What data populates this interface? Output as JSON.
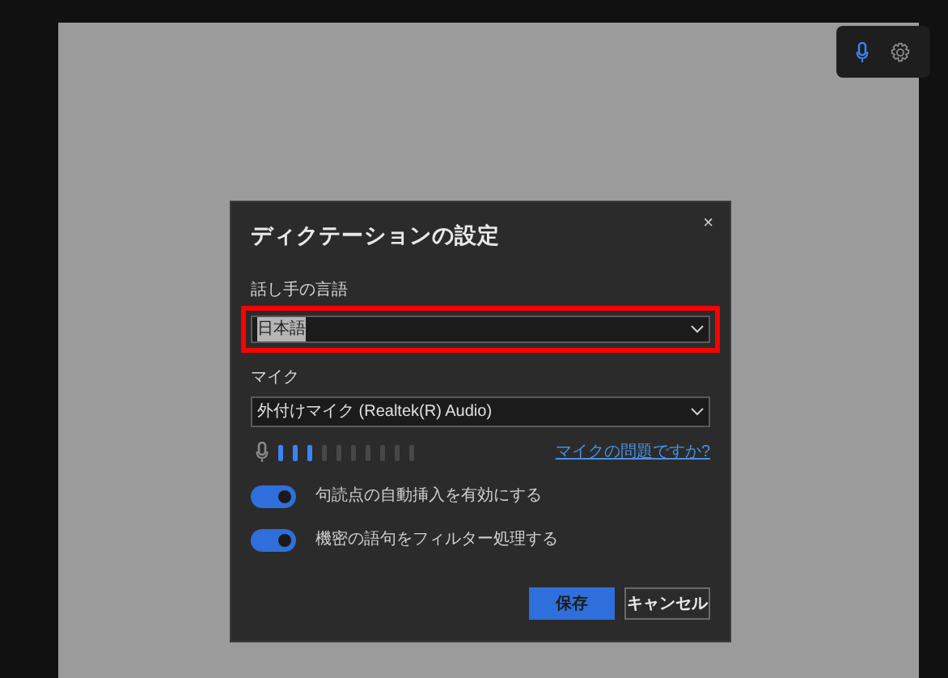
{
  "toolbar": {
    "mic_active": true
  },
  "dialog": {
    "title": "ディクテーションの設定",
    "close": "×",
    "language": {
      "label": "話し手の言語",
      "value": "日本語",
      "text_selected": true,
      "highlighted": true
    },
    "microphone": {
      "label": "マイク",
      "value": "外付けマイク (Realtek(R) Audio)"
    },
    "meter": {
      "level": 0.3
    },
    "help_link": "マイクの問題ですか?",
    "toggles": [
      {
        "label": "句読点の自動挿入を有効にする",
        "on": true
      },
      {
        "label": "機密の語句をフィルター処理する",
        "on": true
      }
    ],
    "buttons": [
      {
        "label": "保存",
        "kind": "primary"
      },
      {
        "label": "キャンセル",
        "kind": "secondary"
      }
    ]
  }
}
